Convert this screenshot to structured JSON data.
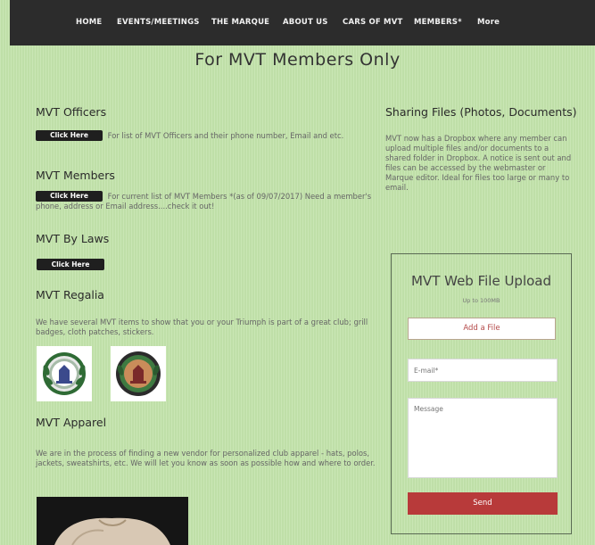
{
  "nav": {
    "items": [
      "HOME",
      "EVENTS/MEETINGS",
      "THE MARQUE",
      "ABOUT US",
      "CARS OF MVT",
      "MEMBERS*",
      "More"
    ]
  },
  "page_title": "For MVT Members Only",
  "officers": {
    "heading": "MVT Officers",
    "button": "Click Here",
    "text": "For list of MVT Officers and their phone number, Email and etc."
  },
  "members": {
    "heading": "MVT Members",
    "button": "Click Here",
    "text": "For current list of MVT Members *(as of 09/07/2017) Need a member's phone, address or Email address....check it out!"
  },
  "bylaws": {
    "heading": "MVT By Laws",
    "button": "Click Here"
  },
  "regalia": {
    "heading": "MVT Regalia",
    "text": "We have several MVT items to show that you or your Triumph is part of a great club; grill badges, cloth patches, stickers."
  },
  "apparel": {
    "heading": "MVT Apparel",
    "text": "We are in the process of finding a new vendor for personalized club apparel - hats, polos, jackets, sweatshirts, etc.  We will let you know as soon as possible how and where to order."
  },
  "sharing": {
    "heading": "Sharing Files (Photos, Documents)",
    "text": "MVT now has a Dropbox where any member can upload multiple files and/or documents to a shared folder in Dropbox. A notice is sent out and files can be accessed by the webmaster or Marque editor.  Ideal for files too large or many to email."
  },
  "upload": {
    "title": "MVT Web File Upload",
    "subtitle": "Up to 100MB",
    "add_file": "Add a File",
    "email_placeholder": "E-mail*",
    "message_placeholder": "Message",
    "send": "Send"
  },
  "colors": {
    "background": "#c3e3ab",
    "navbar": "#2c2c2c",
    "send_button": "#b83a3a",
    "click_button": "#1f1f1f"
  }
}
